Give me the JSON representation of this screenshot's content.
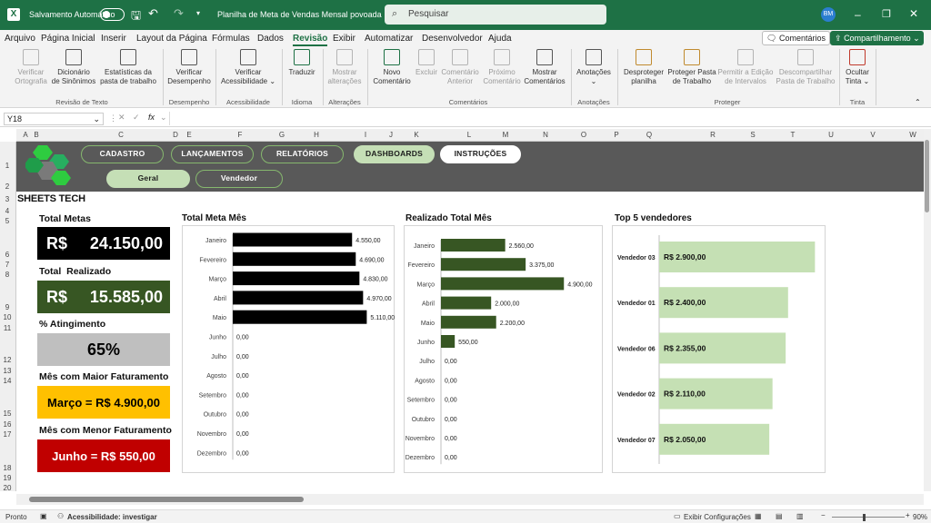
{
  "titlebar": {
    "autosave": "Salvamento Automático",
    "filename": "Planilha de Meta de Vendas Mensal povoada",
    "search_placeholder": "Pesquisar",
    "avatar": "BM"
  },
  "menu": [
    "Arquivo",
    "Página Inicial",
    "Inserir",
    "Layout da Página",
    "Fórmulas",
    "Dados",
    "Revisão",
    "Exibir",
    "Automatizar",
    "Desenvolvedor",
    "Ajuda"
  ],
  "menu_right": {
    "comments": "Comentários",
    "share": "Compartilhamento"
  },
  "ribbon": {
    "buttons": [
      {
        "l1": "Verificar",
        "l2": "Ortografia",
        "disabled": true
      },
      {
        "l1": "Dicionário",
        "l2": "de Sinônimos",
        "disabled": false
      },
      {
        "l1": "Estatísticas da",
        "l2": "pasta de trabalho",
        "disabled": false
      },
      {
        "l1": "Verificar",
        "l2": "Desempenho",
        "disabled": false
      },
      {
        "l1": "Verificar",
        "l2": "Acessibilidade",
        "disabled": false
      },
      {
        "l1": "Traduzir",
        "l2": "",
        "disabled": false
      },
      {
        "l1": "Mostrar",
        "l2": "alterações",
        "disabled": true
      },
      {
        "l1": "Novo",
        "l2": "Comentário",
        "disabled": false
      },
      {
        "l1": "Excluir",
        "l2": "",
        "disabled": true
      },
      {
        "l1": "Comentário",
        "l2": "Anterior",
        "disabled": true
      },
      {
        "l1": "Próximo",
        "l2": "Comentário",
        "disabled": true
      },
      {
        "l1": "Mostrar",
        "l2": "Comentários",
        "disabled": false
      },
      {
        "l1": "Anotações",
        "l2": "",
        "disabled": false
      },
      {
        "l1": "Desproteger",
        "l2": "planilha",
        "disabled": false
      },
      {
        "l1": "Proteger Pasta",
        "l2": "de Trabalho",
        "disabled": false
      },
      {
        "l1": "Permitir a Edição",
        "l2": "de Intervalos",
        "disabled": true
      },
      {
        "l1": "Descompartilhar",
        "l2": "Pasta de Trabalho",
        "disabled": true
      },
      {
        "l1": "Ocultar",
        "l2": "Tinta",
        "disabled": false
      }
    ],
    "groups": [
      "Revisão de Texto",
      "Desempenho",
      "Acessibilidade",
      "Idioma",
      "Alterações",
      "Comentários",
      "Anotações",
      "Proteger",
      "Tinta"
    ]
  },
  "formula": {
    "cell": "Y18",
    "fx": "fx"
  },
  "columns": [
    "A",
    "B",
    "C",
    "D",
    "E",
    "F",
    "G",
    "H",
    "I",
    "J",
    "K",
    "L",
    "M",
    "N",
    "O",
    "P",
    "Q",
    "R",
    "S",
    "T",
    "U",
    "V",
    "W"
  ],
  "rows": [
    "1",
    "2",
    "3",
    "4",
    "5",
    "6",
    "7",
    "8",
    "9",
    "10",
    "11",
    "12",
    "13",
    "14",
    "15",
    "16",
    "17",
    "18",
    "19",
    "20"
  ],
  "nav": {
    "tabs": [
      "CADASTRO",
      "LANÇAMENTOS",
      "RELATÓRIOS",
      "DASHBOARDS",
      "INSTRUÇÕES"
    ],
    "subtabs": [
      "Geral",
      "Vendedor"
    ]
  },
  "brand": "SHEETS TECH",
  "kpis": [
    {
      "title": "Total Metas",
      "prefix": "R$",
      "value": "24.150,00",
      "bg": "#000000",
      "fg": "#ffffff"
    },
    {
      "title": "Total  Realizado",
      "prefix": "R$",
      "value": "15.585,00",
      "bg": "#375623",
      "fg": "#ffffff"
    },
    {
      "title": "% Atingimento",
      "prefix": "",
      "value": "65%",
      "bg": "#bfbfbf",
      "fg": "#000000"
    },
    {
      "title": "Mês com Maior Faturamento",
      "prefix": "",
      "value": "Março = R$ 4.900,00",
      "bg": "#ffc000",
      "fg": "#000000"
    },
    {
      "title": "Mês com Menor Faturamento",
      "prefix": "",
      "value": "Junho = R$ 550,00",
      "bg": "#c00000",
      "fg": "#ffffff"
    }
  ],
  "chart_data": [
    {
      "type": "bar",
      "title": "Total Meta Mês",
      "categories": [
        "Janeiro",
        "Fevereiro",
        "Março",
        "Abril",
        "Maio",
        "Junho",
        "Julho",
        "Agosto",
        "Setembro",
        "Outubro",
        "Novembro",
        "Dezembro"
      ],
      "values": [
        4550,
        4690,
        4830,
        4970,
        5110,
        0,
        0,
        0,
        0,
        0,
        0,
        0
      ],
      "labels": [
        "4.550,00",
        "4.690,00",
        "4.830,00",
        "4.970,00",
        "5.110,00",
        "0,00",
        "0,00",
        "0,00",
        "0,00",
        "0,00",
        "0,00",
        "0,00"
      ],
      "xlim": [
        0,
        5200
      ],
      "color": "#000000"
    },
    {
      "type": "bar",
      "title": "Realizado Total Mês",
      "categories": [
        "Janeiro",
        "Fevereiro",
        "Março",
        "Abril",
        "Maio",
        "Junho",
        "Julho",
        "Agosto",
        "Setembro",
        "Outubro",
        "Novembro",
        "Dezembro"
      ],
      "values": [
        2560,
        3375,
        4900,
        2000,
        2200,
        550,
        0,
        0,
        0,
        0,
        0,
        0
      ],
      "labels": [
        "2.560,00",
        "3.375,00",
        "4.900,00",
        "2.000,00",
        "2.200,00",
        "550,00",
        "0,00",
        "0,00",
        "0,00",
        "0,00",
        "0,00",
        "0,00"
      ],
      "xlim": [
        0,
        5000
      ],
      "color": "#375623"
    },
    {
      "type": "bar",
      "title": "Top 5 vendedores",
      "categories": [
        "Vendedor 03",
        "Vendedor 01",
        "Vendedor 06",
        "Vendedor 02",
        "Vendedor 07"
      ],
      "values": [
        2900,
        2400,
        2355,
        2110,
        2050
      ],
      "labels": [
        "R$ 2.900,00",
        "R$ 2.400,00",
        "R$ 2.355,00",
        "R$ 2.110,00",
        "R$ 2.050,00"
      ],
      "xlim": [
        0,
        3300
      ],
      "color": "#c5e0b4"
    }
  ],
  "status": {
    "ready": "Pronto",
    "access": "Acessibilidade: investigar",
    "display": "Exibir Configurações",
    "zoom": "90%"
  }
}
